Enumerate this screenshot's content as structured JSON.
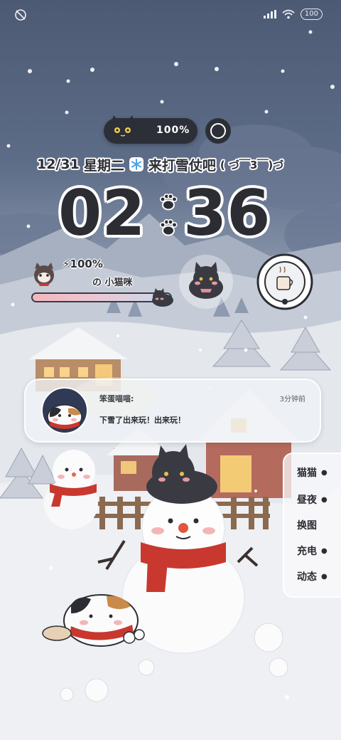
{
  "status_bar": {
    "left_icon": "no-disturb-icon",
    "signal_icon": "signal-bars-icon",
    "wifi_icon": "wifi-icon",
    "battery_value": "100"
  },
  "top_widget": {
    "battery_percent": "100%",
    "cat_icon": "black-cat-face-icon",
    "ring_icon": "ring-button-icon"
  },
  "date_line": {
    "date": "12/31",
    "weekday": "星期二",
    "message": "来打雪仗吧",
    "emoticon": "( づ￣3￣)づ"
  },
  "clock": {
    "hour": "02",
    "minute": "36"
  },
  "battery_widget": {
    "percent": "100%",
    "bolt": "⚡",
    "name_prefix": "の",
    "name": "小猫咪",
    "level": 1.0
  },
  "notification": {
    "sender": "笨蛋喵喵:",
    "time": "3分钟前",
    "message": "下雪了出来玩！出来玩！"
  },
  "side_menu": {
    "items": [
      {
        "label": "猫猫"
      },
      {
        "label": "昼夜"
      },
      {
        "label": "换图"
      },
      {
        "label": "充电"
      },
      {
        "label": "动态"
      }
    ]
  },
  "colors": {
    "sky_top": "#4d5a74",
    "snow": "#f3f4f6",
    "ink": "#2b2d33",
    "scarf_red": "#c8382f"
  }
}
